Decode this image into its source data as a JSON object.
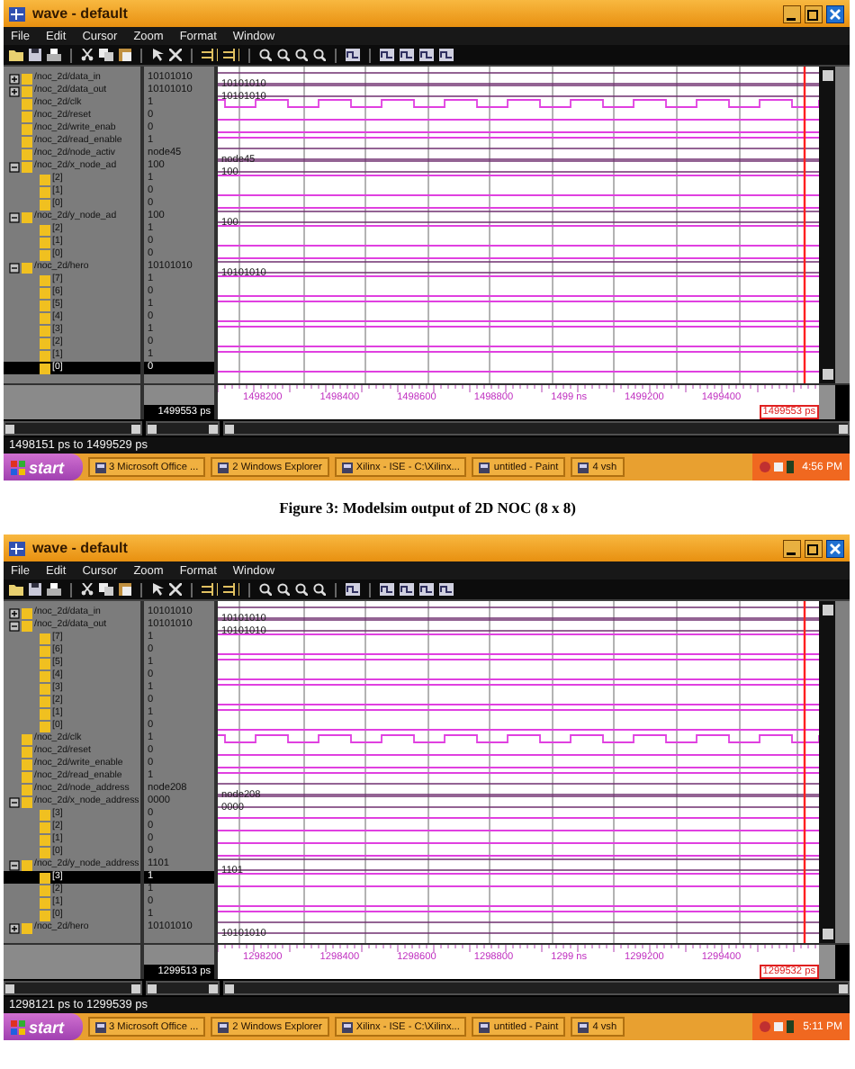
{
  "figures": [
    {
      "window": {
        "title": "wave - default"
      },
      "menu": [
        "File",
        "Edit",
        "Cursor",
        "Zoom",
        "Format",
        "Window"
      ],
      "signals": [
        {
          "name": "/noc_2d/data_in",
          "value": "10101010",
          "kind": "bus",
          "wave_label": "10101010",
          "expanded": false,
          "selected": false
        },
        {
          "name": "/noc_2d/data_out",
          "value": "10101010",
          "kind": "bus",
          "wave_label": "10101010",
          "expanded": false,
          "selected": false
        },
        {
          "name": "/noc_2d/clk",
          "value": "1",
          "kind": "clock",
          "selected": false
        },
        {
          "name": "/noc_2d/reset",
          "value": "0",
          "kind": "low",
          "selected": false
        },
        {
          "name": "/noc_2d/write_enab",
          "value": "0",
          "kind": "low",
          "selected": false
        },
        {
          "name": "/noc_2d/read_enable",
          "value": "1",
          "kind": "high",
          "selected": false
        },
        {
          "name": "/noc_2d/node_activ",
          "value": "node45",
          "kind": "bus",
          "wave_label": "node45",
          "selected": false
        },
        {
          "name": "/noc_2d/x_node_ad",
          "value": "100",
          "kind": "bus",
          "wave_label": "100",
          "expanded": true,
          "selected": false,
          "children": [
            {
              "name": "[2]",
              "value": "1",
              "kind": "high",
              "selected": false
            },
            {
              "name": "[1]",
              "value": "0",
              "kind": "low",
              "selected": false
            },
            {
              "name": "[0]",
              "value": "0",
              "kind": "low",
              "selected": false
            }
          ]
        },
        {
          "name": "/noc_2d/y_node_ad",
          "value": "100",
          "kind": "bus",
          "wave_label": "100",
          "expanded": true,
          "selected": false,
          "children": [
            {
              "name": "[2]",
              "value": "1",
              "kind": "high",
              "selected": false
            },
            {
              "name": "[1]",
              "value": "0",
              "kind": "low",
              "selected": false
            },
            {
              "name": "[0]",
              "value": "0",
              "kind": "low",
              "selected": false
            }
          ]
        },
        {
          "name": "/noc_2d/hero",
          "value": "10101010",
          "kind": "bus",
          "wave_label": "10101010",
          "expanded": true,
          "selected": false,
          "children": [
            {
              "name": "[7]",
              "value": "1",
              "kind": "high",
              "selected": false
            },
            {
              "name": "[6]",
              "value": "0",
              "kind": "low",
              "selected": false
            },
            {
              "name": "[5]",
              "value": "1",
              "kind": "high",
              "selected": false
            },
            {
              "name": "[4]",
              "value": "0",
              "kind": "low",
              "selected": false
            },
            {
              "name": "[3]",
              "value": "1",
              "kind": "high",
              "selected": false
            },
            {
              "name": "[2]",
              "value": "0",
              "kind": "low",
              "selected": false
            },
            {
              "name": "[1]",
              "value": "1",
              "kind": "high",
              "selected": false
            },
            {
              "name": "[0]",
              "value": "0",
              "kind": "low",
              "selected": true
            }
          ]
        }
      ],
      "cursor_time": "1499553 ps",
      "ruler": [
        "1498200",
        "1498400",
        "1498600",
        "1498800",
        "1499 ns",
        "1499200",
        "1499400"
      ],
      "cursor_readout": "1499553 ps",
      "status": "1498151 ps to 1499529 ps",
      "taskbar": {
        "start": "start",
        "items": [
          "3 Microsoft Office ...",
          "2 Windows Explorer",
          "Xilinx - ISE - C:\\Xilinx...",
          "untitled - Paint",
          "4 vsh"
        ],
        "clock": "4:56 PM"
      }
    },
    {
      "window": {
        "title": "wave - default"
      },
      "menu": [
        "File",
        "Edit",
        "Cursor",
        "Zoom",
        "Format",
        "Window"
      ],
      "signals": [
        {
          "name": "/noc_2d/data_in",
          "value": "10101010",
          "kind": "bus",
          "wave_label": "10101010",
          "expanded": false,
          "selected": false
        },
        {
          "name": "/noc_2d/data_out",
          "value": "10101010",
          "kind": "bus",
          "wave_label": "10101010",
          "expanded": true,
          "selected": false,
          "children": [
            {
              "name": "[7]",
              "value": "1",
              "kind": "high",
              "selected": false
            },
            {
              "name": "[6]",
              "value": "0",
              "kind": "low",
              "selected": false
            },
            {
              "name": "[5]",
              "value": "1",
              "kind": "high",
              "selected": false
            },
            {
              "name": "[4]",
              "value": "0",
              "kind": "low",
              "selected": false
            },
            {
              "name": "[3]",
              "value": "1",
              "kind": "high",
              "selected": false
            },
            {
              "name": "[2]",
              "value": "0",
              "kind": "low",
              "selected": false
            },
            {
              "name": "[1]",
              "value": "1",
              "kind": "high",
              "selected": false
            },
            {
              "name": "[0]",
              "value": "0",
              "kind": "low",
              "selected": false
            }
          ]
        },
        {
          "name": "/noc_2d/clk",
          "value": "1",
          "kind": "clock",
          "selected": false
        },
        {
          "name": "/noc_2d/reset",
          "value": "0",
          "kind": "low",
          "selected": false
        },
        {
          "name": "/noc_2d/write_enable",
          "value": "0",
          "kind": "low",
          "selected": false
        },
        {
          "name": "/noc_2d/read_enable",
          "value": "1",
          "kind": "high",
          "selected": false
        },
        {
          "name": "/noc_2d/node_address",
          "value": "node208",
          "kind": "bus",
          "wave_label": "node208",
          "selected": false
        },
        {
          "name": "/noc_2d/x_node_address",
          "value": "0000",
          "kind": "bus",
          "wave_label": "0000",
          "expanded": true,
          "selected": false,
          "children": [
            {
              "name": "[3]",
              "value": "0",
              "kind": "low",
              "selected": false
            },
            {
              "name": "[2]",
              "value": "0",
              "kind": "low",
              "selected": false
            },
            {
              "name": "[1]",
              "value": "0",
              "kind": "low",
              "selected": false
            },
            {
              "name": "[0]",
              "value": "0",
              "kind": "low",
              "selected": false
            }
          ]
        },
        {
          "name": "/noc_2d/y_node_address",
          "value": "1101",
          "kind": "bus",
          "wave_label": "1101",
          "expanded": true,
          "selected": false,
          "children": [
            {
              "name": "[3]",
              "value": "1",
              "kind": "high",
              "selected": true
            },
            {
              "name": "[2]",
              "value": "1",
              "kind": "high",
              "selected": false
            },
            {
              "name": "[1]",
              "value": "0",
              "kind": "low",
              "selected": false
            },
            {
              "name": "[0]",
              "value": "1",
              "kind": "high",
              "selected": false
            }
          ]
        },
        {
          "name": "/noc_2d/hero",
          "value": "10101010",
          "kind": "bus",
          "wave_label": "10101010",
          "expanded": false,
          "selected": false
        }
      ],
      "cursor_time": "1299513 ps",
      "ruler": [
        "1298200",
        "1298400",
        "1298600",
        "1298800",
        "1299 ns",
        "1299200",
        "1299400"
      ],
      "cursor_readout": "1299532 ps",
      "status": "1298121 ps to 1299539 ps",
      "taskbar": {
        "start": "start",
        "items": [
          "3 Microsoft Office ...",
          "2 Windows Explorer",
          "Xilinx - ISE - C:\\Xilinx...",
          "untitled - Paint",
          "4 vsh"
        ],
        "clock": "5:11 PM"
      }
    }
  ],
  "caption": "Figure 3: Modelsim output of 2D NOC (8 x 8)"
}
